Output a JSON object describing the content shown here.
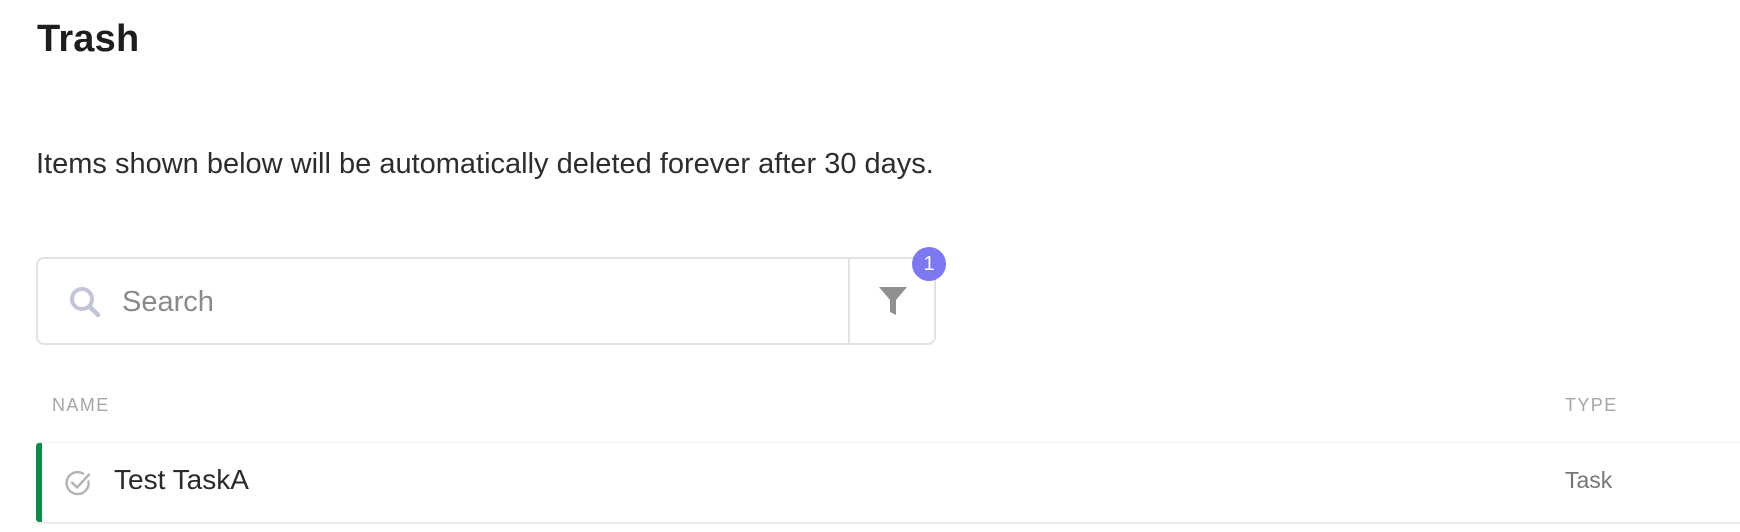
{
  "page": {
    "title": "Trash",
    "description": "Items shown below will be automatically deleted forever after 30 days."
  },
  "search": {
    "placeholder": "Search",
    "value": "",
    "icon": "search-icon"
  },
  "filter": {
    "icon": "filter-icon",
    "badge_count": "1",
    "badge_color": "#7b78f0"
  },
  "table": {
    "columns": [
      "NAME",
      "TYPE"
    ],
    "rows": [
      {
        "name": "Test TaskA",
        "type": "Task",
        "icon": "task-check-icon",
        "accent_color": "#0f8a48"
      }
    ]
  }
}
